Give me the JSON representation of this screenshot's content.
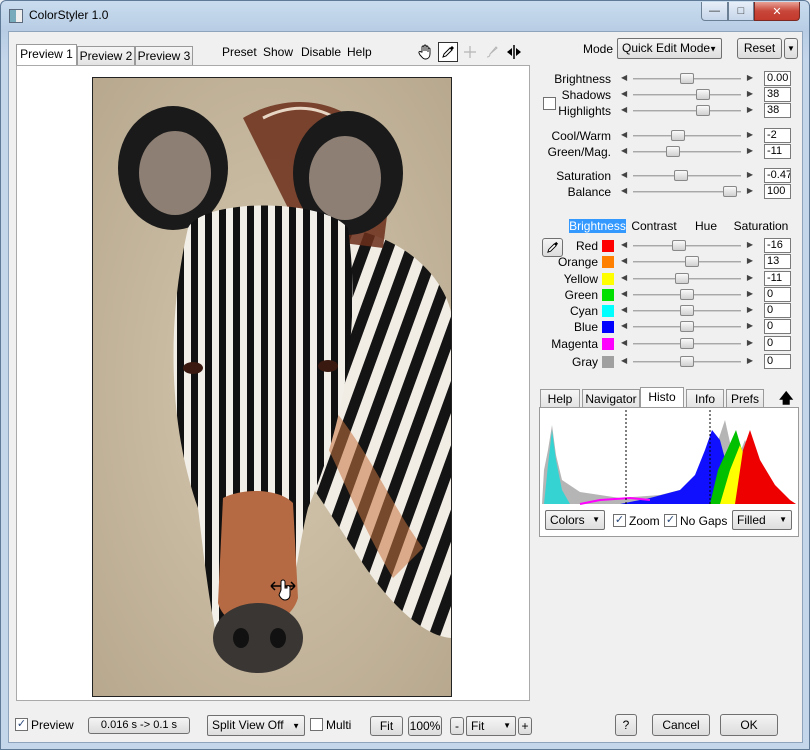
{
  "window": {
    "title": "ColorStyler 1.0",
    "controls": {
      "minimize": "—",
      "maximize": "□",
      "close": "✕"
    }
  },
  "preview_tabs": [
    "Preview 1",
    "Preview 2",
    "Preview 3"
  ],
  "menu": [
    "Preset",
    "Show",
    "Disable",
    "Help"
  ],
  "tools": [
    "hand-icon",
    "eyedropper-icon",
    "crosshair-icon",
    "brush-icon",
    "split-arrows-icon"
  ],
  "mode": {
    "label": "Mode",
    "value": "Quick Edit Mode"
  },
  "reset_label": "Reset",
  "tone": [
    {
      "label": "Brightness",
      "value": "0.00",
      "position": 0.5
    },
    {
      "label": "Shadows",
      "value": "38",
      "position": 0.65
    },
    {
      "label": "Highlights",
      "value": "38",
      "position": 0.65
    }
  ],
  "balance": [
    {
      "label": "Cool/Warm",
      "value": "-2",
      "position": 0.42
    },
    {
      "label": "Green/Mag.",
      "value": "-11",
      "position": 0.37
    }
  ],
  "saturation": [
    {
      "label": "Saturation",
      "value": "-0.47",
      "position": 0.44
    },
    {
      "label": "Balance",
      "value": "100",
      "position": 0.9
    }
  ],
  "channel_tabs": [
    "Brightness",
    "Contrast",
    "Hue",
    "Saturation"
  ],
  "channels": [
    {
      "label": "Red",
      "color": "#ff0000",
      "value": "-16",
      "position": 0.43
    },
    {
      "label": "Orange",
      "color": "#ff8000",
      "value": "13",
      "position": 0.55
    },
    {
      "label": "Yellow",
      "color": "#ffff00",
      "value": "-11",
      "position": 0.45
    },
    {
      "label": "Green",
      "color": "#00e000",
      "value": "0",
      "position": 0.5
    },
    {
      "label": "Cyan",
      "color": "#00ffff",
      "value": "0",
      "position": 0.5
    },
    {
      "label": "Blue",
      "color": "#0000ff",
      "value": "0",
      "position": 0.5
    },
    {
      "label": "Magenta",
      "color": "#ff00ff",
      "value": "0",
      "position": 0.5
    },
    {
      "label": "Gray",
      "color": "#a0a0a0",
      "value": "0",
      "position": 0.5
    }
  ],
  "panel_tabs": [
    "Help",
    "Navigator",
    "Histo",
    "Info",
    "Prefs"
  ],
  "histogram": {
    "colors_select": "Colors",
    "zoom_label": "Zoom",
    "nogaps_label": "No Gaps",
    "fill_select": "Filled"
  },
  "bottom": {
    "preview_label": "Preview",
    "timing": "0.016 s -> 0.1 s",
    "split_view": "Split View Off",
    "multi_label": "Multi",
    "fit_label": "Fit",
    "zoom_100": "100%",
    "minus": "-",
    "zoom_select": "Fit",
    "plus": "+",
    "help": "?",
    "cancel": "Cancel",
    "ok": "OK"
  }
}
